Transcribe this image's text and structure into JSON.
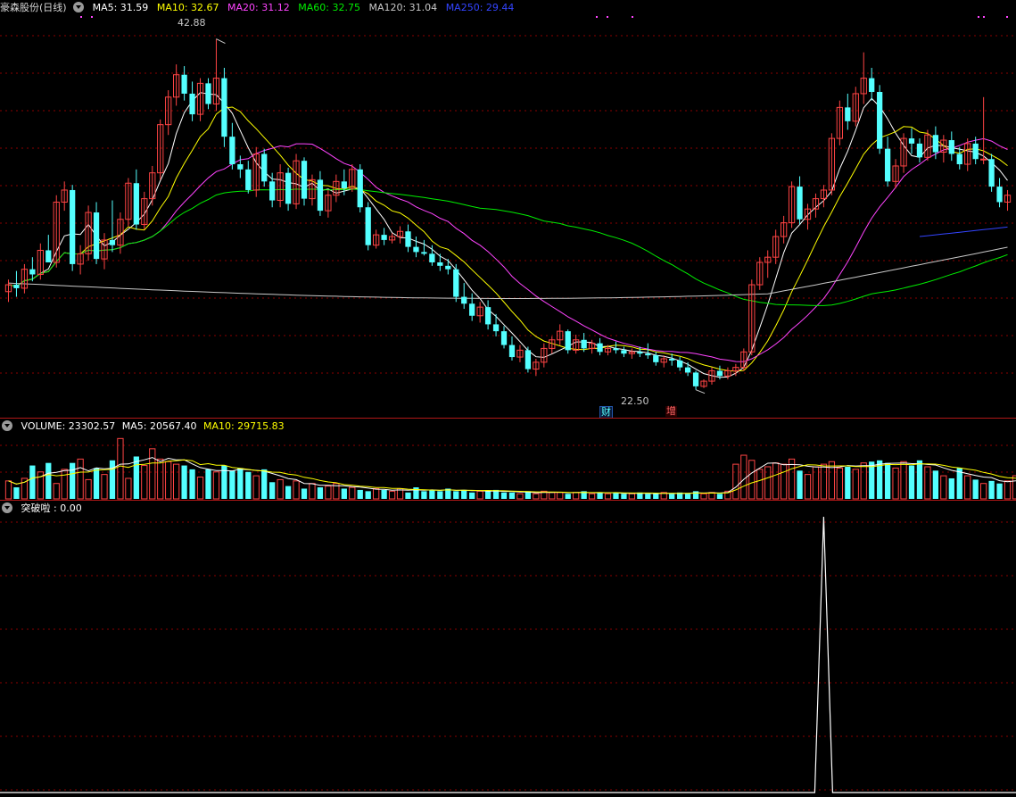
{
  "price_header": {
    "title": "豪森股份(日线)",
    "ma5": "MA5: 31.59",
    "ma10": "MA10: 32.67",
    "ma20": "MA20: 31.12",
    "ma60": "MA60: 32.75",
    "ma120": "MA120: 31.04",
    "ma250": "MA250: 29.44"
  },
  "volume_header": {
    "vol": "VOLUME: 23302.57",
    "ma5": "MA5: 20567.40",
    "ma10": "MA10: 29715.83"
  },
  "indicator_header": {
    "name": "突破啦",
    "value": ": 0.00"
  },
  "markers": {
    "high_label": "42.88",
    "low_label": "22.50",
    "event_a": "财",
    "event_b": "增"
  },
  "colors": {
    "up": "#ff4444",
    "down": "#54ffff",
    "ma5": "#ffffff",
    "ma10": "#ffff00",
    "ma20": "#ff44ff",
    "ma60": "#00ee00",
    "ma120": "#c8c8c8",
    "ma250": "#3344ff",
    "grid": "#8b0000"
  },
  "chart_data": [
    {
      "type": "candlestick",
      "ylim": [
        21.5,
        44
      ],
      "high": 42.88,
      "low": 22.5,
      "candles": [
        [
          28.2,
          28.9,
          27.6,
          28.6
        ],
        [
          28.6,
          29.4,
          27.9,
          28.4
        ],
        [
          28.4,
          29.8,
          28.1,
          29.5
        ],
        [
          29.5,
          30.2,
          28.8,
          29.2
        ],
        [
          29.2,
          31.0,
          28.9,
          30.6
        ],
        [
          30.6,
          31.5,
          30.1,
          29.9
        ],
        [
          29.9,
          33.8,
          29.6,
          33.4
        ],
        [
          33.4,
          34.6,
          32.9,
          34.1
        ],
        [
          34.1,
          34.4,
          29.4,
          29.8
        ],
        [
          29.8,
          30.9,
          29.2,
          30.4
        ],
        [
          30.4,
          33.2,
          30.0,
          32.8
        ],
        [
          32.8,
          33.4,
          29.8,
          30.1
        ],
        [
          30.1,
          31.6,
          29.5,
          31.2
        ],
        [
          31.2,
          33.5,
          30.5,
          30.9
        ],
        [
          30.9,
          32.8,
          30.4,
          32.4
        ],
        [
          32.4,
          34.8,
          32.0,
          34.5
        ],
        [
          34.5,
          35.3,
          31.8,
          32.1
        ],
        [
          32.1,
          34.0,
          31.8,
          33.6
        ],
        [
          33.6,
          35.5,
          33.2,
          35.1
        ],
        [
          35.1,
          38.2,
          34.7,
          37.9
        ],
        [
          37.9,
          39.9,
          37.3,
          39.5
        ],
        [
          39.5,
          41.4,
          39.0,
          40.8
        ],
        [
          40.8,
          41.3,
          39.3,
          39.7
        ],
        [
          39.7,
          40.4,
          38.1,
          38.5
        ],
        [
          38.5,
          40.6,
          38.1,
          40.3
        ],
        [
          40.3,
          40.6,
          38.8,
          39.1
        ],
        [
          39.1,
          42.88,
          38.7,
          40.6
        ],
        [
          40.6,
          41.2,
          36.6,
          37.2
        ],
        [
          37.2,
          38.0,
          35.3,
          35.6
        ],
        [
          35.6,
          36.1,
          34.8,
          35.3
        ],
        [
          35.3,
          35.8,
          33.9,
          34.1
        ],
        [
          34.1,
          36.6,
          33.7,
          36.2
        ],
        [
          36.2,
          36.5,
          34.3,
          34.6
        ],
        [
          34.6,
          35.1,
          33.1,
          33.5
        ],
        [
          33.5,
          35.6,
          33.1,
          35.1
        ],
        [
          35.1,
          35.4,
          32.9,
          33.3
        ],
        [
          33.3,
          36.2,
          33.0,
          35.8
        ],
        [
          35.8,
          36.0,
          33.2,
          33.6
        ],
        [
          33.6,
          35.0,
          33.2,
          34.7
        ],
        [
          34.7,
          35.2,
          32.6,
          32.9
        ],
        [
          32.9,
          34.1,
          32.5,
          33.8
        ],
        [
          33.8,
          35.0,
          33.4,
          34.6
        ],
        [
          34.6,
          35.3,
          33.8,
          34.2
        ],
        [
          34.2,
          35.6,
          34.0,
          35.3
        ],
        [
          35.3,
          35.6,
          32.8,
          33.1
        ],
        [
          33.1,
          33.4,
          30.6,
          30.9
        ],
        [
          30.9,
          31.8,
          30.7,
          31.5
        ],
        [
          31.5,
          31.9,
          30.9,
          31.2
        ],
        [
          31.2,
          31.6,
          31.0,
          31.4
        ],
        [
          31.4,
          32.0,
          31.0,
          31.7
        ],
        [
          31.7,
          32.1,
          30.5,
          30.8
        ],
        [
          30.8,
          31.4,
          30.2,
          30.5
        ],
        [
          30.5,
          31.2,
          30.3,
          30.4
        ],
        [
          30.4,
          30.9,
          29.7,
          29.9
        ],
        [
          29.9,
          30.4,
          29.4,
          29.7
        ],
        [
          29.7,
          30.1,
          29.2,
          29.5
        ],
        [
          29.5,
          29.8,
          27.6,
          27.9
        ],
        [
          27.9,
          28.7,
          27.2,
          27.5
        ],
        [
          27.5,
          28.1,
          26.5,
          26.8
        ],
        [
          26.8,
          27.6,
          26.4,
          27.3
        ],
        [
          27.3,
          27.7,
          26.0,
          26.3
        ],
        [
          26.3,
          26.9,
          25.6,
          25.9
        ],
        [
          25.9,
          26.2,
          24.9,
          25.1
        ],
        [
          25.1,
          25.6,
          24.2,
          24.4
        ],
        [
          24.4,
          25.1,
          24.1,
          24.8
        ],
        [
          24.8,
          25.0,
          23.5,
          23.7
        ],
        [
          23.7,
          24.3,
          23.3,
          24.1
        ],
        [
          24.1,
          25.2,
          23.8,
          24.9
        ],
        [
          24.9,
          25.6,
          24.6,
          25.4
        ],
        [
          25.4,
          26.3,
          25.1,
          25.9
        ],
        [
          25.9,
          26.0,
          24.6,
          24.8
        ],
        [
          24.8,
          25.7,
          24.6,
          25.4
        ],
        [
          25.4,
          25.8,
          24.7,
          24.9
        ],
        [
          24.9,
          25.4,
          24.6,
          25.2
        ],
        [
          25.2,
          25.5,
          24.5,
          24.7
        ],
        [
          24.7,
          25.1,
          24.5,
          24.9
        ],
        [
          24.9,
          25.3,
          24.6,
          24.8
        ],
        [
          24.8,
          25.0,
          24.4,
          24.6
        ],
        [
          24.6,
          24.9,
          24.3,
          24.7
        ],
        [
          24.7,
          25.0,
          24.4,
          24.6
        ],
        [
          24.6,
          25.2,
          24.3,
          24.5
        ],
        [
          24.5,
          24.7,
          23.9,
          24.1
        ],
        [
          24.1,
          24.5,
          23.8,
          24.3
        ],
        [
          24.3,
          24.6,
          23.9,
          24.2
        ],
        [
          24.2,
          24.4,
          23.6,
          23.8
        ],
        [
          23.8,
          24.1,
          23.3,
          23.5
        ],
        [
          23.5,
          23.6,
          22.5,
          22.7
        ],
        [
          22.7,
          23.1,
          22.6,
          23.0
        ],
        [
          23.0,
          23.8,
          22.8,
          23.6
        ],
        [
          23.6,
          23.9,
          23.1,
          23.3
        ],
        [
          23.3,
          23.8,
          23.1,
          23.6
        ],
        [
          23.6,
          24.0,
          23.3,
          23.8
        ],
        [
          23.8,
          24.9,
          23.6,
          24.7
        ],
        [
          24.7,
          28.9,
          24.5,
          28.6
        ],
        [
          28.6,
          30.2,
          28.3,
          29.9
        ],
        [
          29.9,
          30.6,
          29.0,
          30.2
        ],
        [
          30.2,
          31.8,
          29.8,
          31.4
        ],
        [
          31.4,
          32.6,
          31.0,
          32.2
        ],
        [
          32.2,
          34.6,
          31.9,
          34.3
        ],
        [
          34.3,
          34.9,
          32.1,
          32.4
        ],
        [
          32.4,
          33.3,
          31.8,
          33.0
        ],
        [
          33.0,
          33.9,
          32.5,
          33.6
        ],
        [
          33.6,
          34.4,
          33.1,
          34.1
        ],
        [
          34.1,
          37.4,
          33.8,
          37.1
        ],
        [
          37.1,
          39.3,
          36.7,
          38.9
        ],
        [
          38.9,
          39.7,
          37.6,
          38.1
        ],
        [
          38.1,
          40.1,
          37.8,
          39.7
        ],
        [
          39.7,
          42.1,
          39.1,
          40.6
        ],
        [
          40.6,
          41.2,
          39.3,
          39.8
        ],
        [
          39.8,
          40.2,
          36.2,
          36.5
        ],
        [
          36.5,
          37.2,
          34.3,
          34.6
        ],
        [
          34.6,
          35.9,
          34.2,
          35.5
        ],
        [
          35.5,
          37.4,
          35.1,
          37.1
        ],
        [
          37.1,
          37.7,
          36.2,
          36.8
        ],
        [
          36.8,
          37.1,
          35.7,
          36.0
        ],
        [
          36.0,
          37.6,
          35.8,
          37.3
        ],
        [
          37.3,
          37.8,
          35.9,
          36.3
        ],
        [
          36.3,
          37.3,
          35.7,
          37.0
        ],
        [
          37.0,
          37.5,
          35.8,
          36.2
        ],
        [
          36.2,
          36.6,
          35.3,
          35.6
        ],
        [
          35.6,
          37.1,
          35.2,
          36.8
        ],
        [
          36.8,
          37.2,
          35.6,
          35.9
        ],
        [
          35.9,
          39.5,
          35.6,
          35.9
        ],
        [
          35.9,
          36.2,
          34.0,
          34.3
        ],
        [
          34.3,
          34.8,
          33.1,
          33.4
        ],
        [
          33.4,
          34.1,
          32.9,
          33.8
        ]
      ]
    },
    {
      "type": "bar",
      "series": "VOLUME",
      "ylim": [
        0,
        50000
      ],
      "values": [
        14000,
        9000,
        16000,
        26000,
        21000,
        28000,
        12000,
        23000,
        28000,
        31000,
        15000,
        24000,
        19000,
        30000,
        47000,
        16000,
        33000,
        26000,
        39000,
        31000,
        29000,
        27000,
        26000,
        23000,
        17000,
        23000,
        21000,
        26000,
        22000,
        24000,
        21000,
        18000,
        23000,
        13000,
        15000,
        10000,
        14000,
        8000,
        12000,
        9000,
        10000,
        12000,
        8000,
        9000,
        7000,
        6000,
        8000,
        7000,
        6000,
        8000,
        5000,
        9000,
        6000,
        7000,
        6000,
        8000,
        6000,
        7000,
        5000,
        6000,
        6000,
        7000,
        5000,
        5000,
        4000,
        6000,
        4000,
        6000,
        5000,
        5000,
        4000,
        5000,
        6000,
        4000,
        5000,
        4000,
        5000,
        4000,
        4000,
        5000,
        4000,
        4000,
        5000,
        4000,
        5000,
        4000,
        6000,
        4000,
        5000,
        4000,
        6000,
        27000,
        34000,
        30000,
        23000,
        25000,
        28000,
        27000,
        31000,
        22000,
        19000,
        25000,
        27000,
        29000,
        24000,
        25000,
        23000,
        28000,
        29000,
        30000,
        28000,
        24000,
        29000,
        26000,
        30000,
        25000,
        22000,
        18000,
        16000,
        24000,
        18000,
        15000,
        12000,
        14000,
        12000,
        14000,
        18000,
        16000,
        10000
      ]
    },
    {
      "type": "line",
      "series": "突破啦",
      "ylim": [
        0,
        1
      ],
      "spike_index": 102,
      "spike_value": 1
    }
  ]
}
